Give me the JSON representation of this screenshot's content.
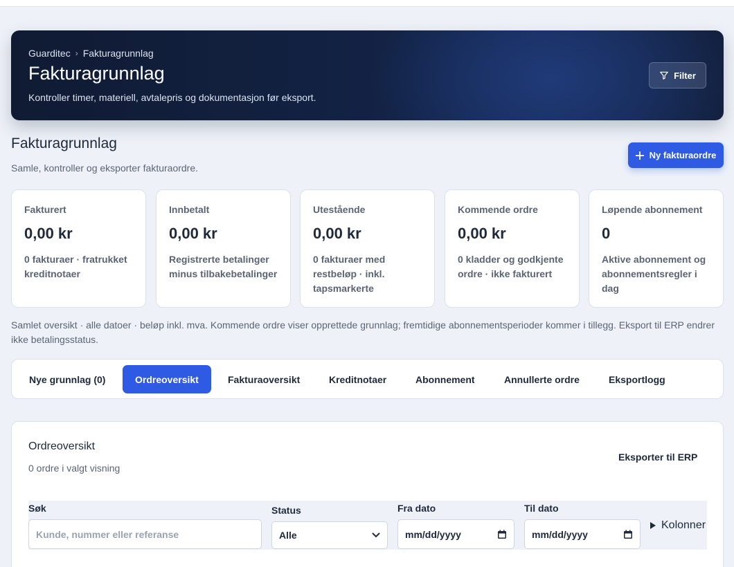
{
  "breadcrumb": [
    "Guarditec",
    "Fakturagrunnlag"
  ],
  "hero": {
    "title": "Fakturagrunnlag",
    "subtitle": "Kontroller timer, materiell, avtalepris og dokumentasjon før eksport.",
    "filter_label": "Filter"
  },
  "section": {
    "title": "Fakturagrunnlag",
    "subtitle": "Samle, kontroller og eksporter fakturaordre.",
    "new_button": "Ny fakturaordre"
  },
  "kpis": [
    {
      "label": "Fakturert",
      "value": "0,00 kr",
      "desc": "0 fakturaer · fratrukket kreditnotaer"
    },
    {
      "label": "Innbetalt",
      "value": "0,00 kr",
      "desc": "Registrerte betalinger minus tilbakebetalinger"
    },
    {
      "label": "Utestående",
      "value": "0,00 kr",
      "desc": "0 fakturaer med restbeløp · inkl. tapsmarkerte"
    },
    {
      "label": "Kommende ordre",
      "value": "0,00 kr",
      "desc": "0 kladder og godkjente ordre · ikke fakturert"
    },
    {
      "label": "Løpende abonnement",
      "value": "0",
      "desc": "Aktive abonnement og abonnementsregler i dag"
    }
  ],
  "note": "Samlet oversikt · alle datoer · beløp inkl. mva. Kommende ordre viser opprettede grunnlag; fremtidige abonnementsperioder kommer i tillegg. Eksport til ERP endrer ikke betalingsstatus.",
  "tabs": [
    {
      "label": "Nye grunnlag (0)",
      "active": false
    },
    {
      "label": "Ordreoversikt",
      "active": true
    },
    {
      "label": "Fakturaoversikt",
      "active": false
    },
    {
      "label": "Kreditnotaer",
      "active": false
    },
    {
      "label": "Abonnement",
      "active": false
    },
    {
      "label": "Annullerte ordre",
      "active": false
    },
    {
      "label": "Eksportlogg",
      "active": false
    }
  ],
  "panel": {
    "title": "Ordreoversikt",
    "subtitle": "0 ordre i valgt visning",
    "export_button": "Eksporter til ERP",
    "filters": {
      "search_label": "Søk",
      "search_placeholder": "Kunde, nummer eller referanse",
      "status_label": "Status",
      "status_value": "Alle",
      "from_label": "Fra dato",
      "from_value": "mm/dd/yyyy",
      "to_label": "Til dato",
      "to_value": "mm/dd/yyyy",
      "columns_label": "Kolonner"
    }
  },
  "colors": {
    "accent": "#2f5be4",
    "hero_dark": "#132346",
    "background": "#eef2f8"
  }
}
